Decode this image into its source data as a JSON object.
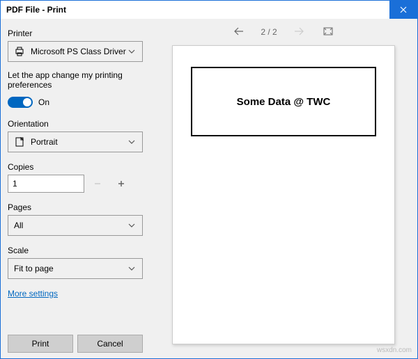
{
  "titlebar": {
    "title": "PDF File - Print"
  },
  "sidebar": {
    "printer_label": "Printer",
    "printer_value": "Microsoft PS Class Driver",
    "pref_label": "Let the app change my printing preferences",
    "pref_state": "On",
    "orientation_label": "Orientation",
    "orientation_value": "Portrait",
    "copies_label": "Copies",
    "copies_value": "1",
    "pages_label": "Pages",
    "pages_value": "All",
    "scale_label": "Scale",
    "scale_value": "Fit to page",
    "more_settings": "More settings",
    "print_btn": "Print",
    "cancel_btn": "Cancel"
  },
  "preview": {
    "page_indicator": "2 / 2",
    "page_content": "Some Data @ TWC"
  },
  "watermark": "wsxdn.com"
}
